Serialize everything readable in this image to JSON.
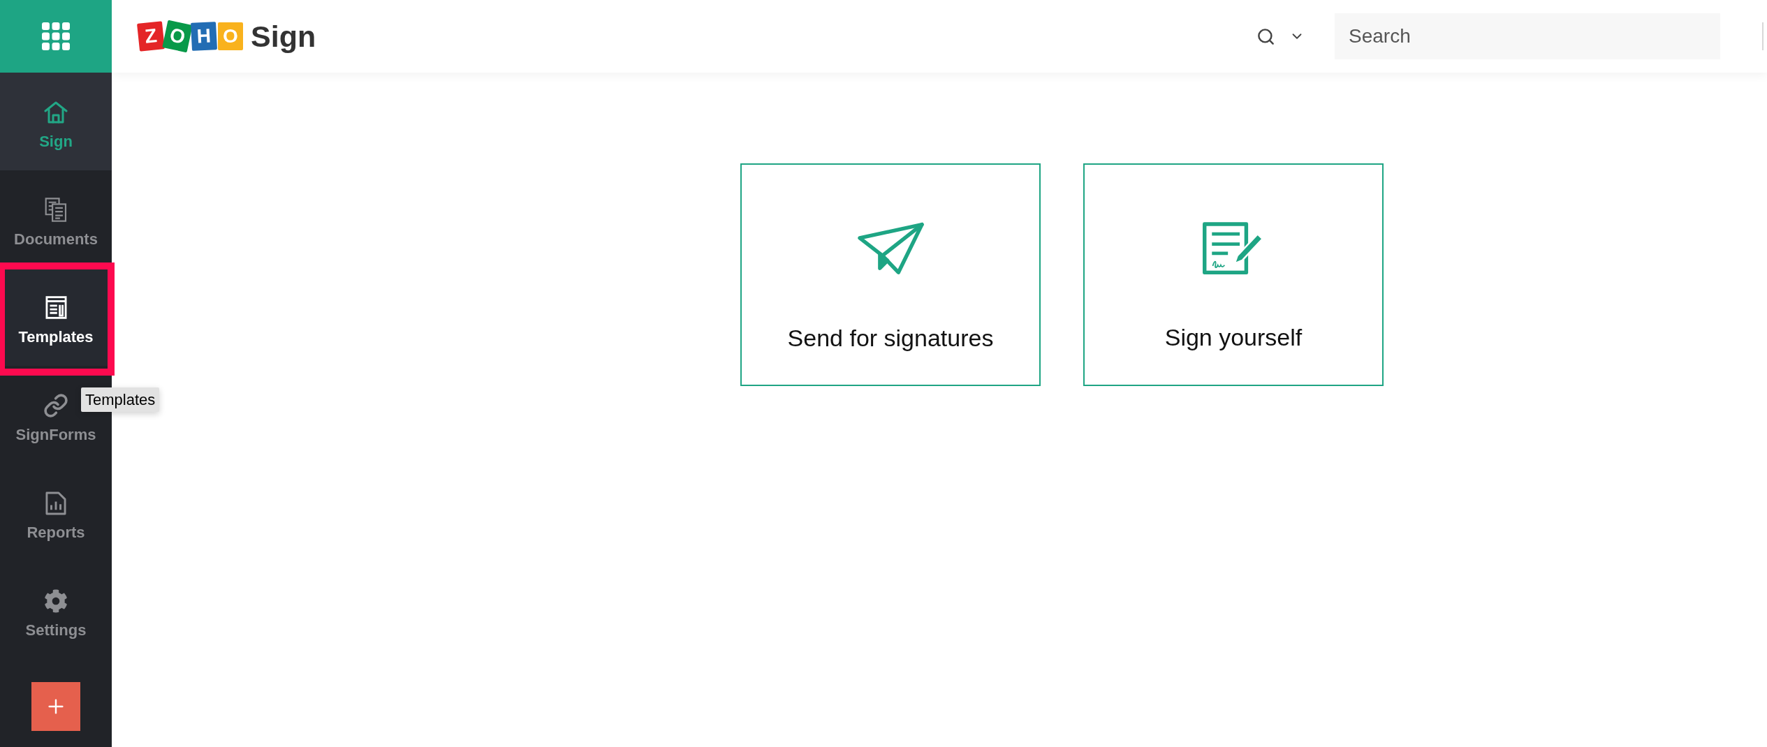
{
  "sidebar": {
    "items": [
      {
        "label": "Sign",
        "selected": true,
        "highlighted": false
      },
      {
        "label": "Documents",
        "selected": false,
        "highlighted": false
      },
      {
        "label": "Templates",
        "selected": false,
        "highlighted": true
      },
      {
        "label": "SignForms",
        "selected": false,
        "highlighted": false
      },
      {
        "label": "Reports",
        "selected": false,
        "highlighted": false
      },
      {
        "label": "Settings",
        "selected": false,
        "highlighted": false
      }
    ]
  },
  "tooltip": {
    "text": "Templates"
  },
  "header": {
    "logo": {
      "tiles": [
        {
          "letter": "Z",
          "color": "#e42527"
        },
        {
          "letter": "O",
          "color": "#089949"
        },
        {
          "letter": "H",
          "color": "#226db4"
        },
        {
          "letter": "O",
          "color": "#f9b21d"
        }
      ],
      "product": "Sign"
    },
    "search": {
      "placeholder": "Search"
    }
  },
  "actions": [
    {
      "label": "Send for signatures"
    },
    {
      "label": "Sign yourself"
    }
  ]
}
